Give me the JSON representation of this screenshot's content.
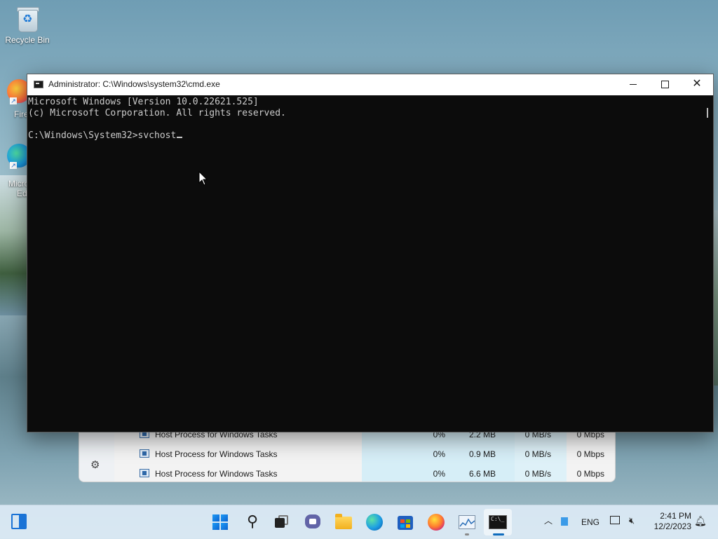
{
  "desktop": {
    "recycle_bin_label": "Recycle Bin",
    "firefox_label_partial": "Fire",
    "edge_label_partial_1": "Micro",
    "edge_label_partial_2": "Ed"
  },
  "task_manager": {
    "rows": [
      {
        "name": "Host Process for Windows Tasks",
        "cpu": "0%",
        "memory": "2.2 MB",
        "disk": "0 MB/s",
        "network": "0 Mbps"
      },
      {
        "name": "Host Process for Windows Tasks",
        "cpu": "0%",
        "memory": "0.9 MB",
        "disk": "0 MB/s",
        "network": "0 Mbps"
      },
      {
        "name": "Host Process for Windows Tasks",
        "cpu": "0%",
        "memory": "6.6 MB",
        "disk": "0 MB/s",
        "network": "0 Mbps"
      }
    ],
    "settings_icon": "gear-icon"
  },
  "cmd_window": {
    "title": "Administrator: C:\\Windows\\system32\\cmd.exe",
    "console_lines": [
      "Microsoft Windows [Version 10.0.22621.525]",
      "(c) Microsoft Corporation. All rights reserved.",
      "",
      "C:\\Windows\\System32>svchost"
    ]
  },
  "taskbar": {
    "language": "ENG",
    "time": "2:41 PM",
    "date": "12/2/2023",
    "apps": [
      "widgets-icon",
      "start-icon",
      "search-icon",
      "task-view-icon",
      "chat-icon",
      "file-explorer-icon",
      "edge-icon",
      "store-icon",
      "firefox-icon",
      "performance-monitor-icon",
      "command-prompt-icon"
    ],
    "active_app": "command-prompt-icon",
    "accent_color": "#0f6cbd"
  },
  "colors": {
    "console_bg": "#0c0c0c",
    "console_fg": "#cccccc"
  }
}
